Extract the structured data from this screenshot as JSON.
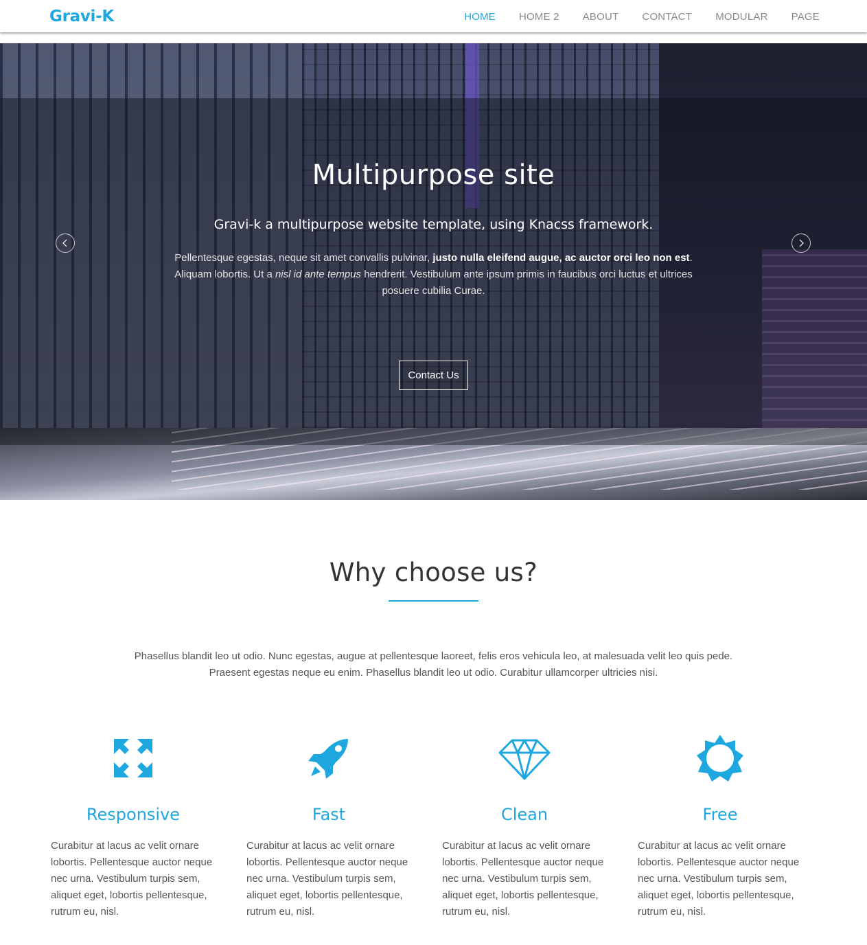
{
  "header": {
    "logo": "Gravi-K",
    "nav": [
      {
        "label": "HOME",
        "active": true
      },
      {
        "label": "HOME 2",
        "active": false
      },
      {
        "label": "ABOUT",
        "active": false
      },
      {
        "label": "CONTACT",
        "active": false
      },
      {
        "label": "MODULAR",
        "active": false
      },
      {
        "label": "PAGE",
        "active": false
      }
    ]
  },
  "hero": {
    "title": "Multipurpose  site",
    "subtitle": "Gravi-k a multipurpose website template, using Knacss framework.",
    "text_part1": "Pellentesque egestas, neque sit amet convallis pulvinar, ",
    "text_bold": "justo nulla eleifend augue, ac auctor orci leo non est",
    "text_part2": ". Aliquam lobortis. Ut a ",
    "text_italic": "nisl id ante tempus",
    "text_part3": " hendrerit. Vestibulum ante ipsum primis in faucibus orci luctus et ultrices posuere cubilia Curae.",
    "button_label": "Contact Us",
    "prev_icon": "chevron-left-icon",
    "next_icon": "chevron-right-icon"
  },
  "why": {
    "title": "Why choose us?",
    "text": "Phasellus blandit leo ut odio. Nunc egestas, augue at pellentesque laoreet, felis eros vehicula leo, at malesuada velit leo quis pede. Praesent egestas neque eu enim. Phasellus blandit leo ut odio. Curabitur ullamcorper ultricies nisi."
  },
  "features": [
    {
      "title": "Responsive",
      "icon": "expand-arrows-icon",
      "text": "Curabitur at lacus ac velit ornare lobortis. Pellentesque auctor neque nec urna. Vestibulum turpis sem, aliquet eget, lobortis pellentesque, rutrum eu, nisl."
    },
    {
      "title": "Fast",
      "icon": "rocket-icon",
      "text": "Curabitur at lacus ac velit ornare lobortis. Pellentesque auctor neque nec urna. Vestibulum turpis sem, aliquet eget, lobortis pellentesque, rutrum eu, nisl."
    },
    {
      "title": "Clean",
      "icon": "diamond-icon",
      "text": "Curabitur at lacus ac velit ornare lobortis. Pellentesque auctor neque nec urna. Vestibulum turpis sem, aliquet eget, lobortis pellentesque, rutrum eu, nisl."
    },
    {
      "title": "Free",
      "icon": "sun-icon",
      "text": "Curabitur at lacus ac velit ornare lobortis. Pellentesque auctor neque nec urna. Vestibulum turpis sem, aliquet eget, lobortis pellentesque, rutrum eu, nisl."
    }
  ],
  "colors": {
    "accent": "#1fa8e0",
    "nav_inactive": "#8a8a8a",
    "heading": "#333333",
    "body_text": "#555555"
  }
}
